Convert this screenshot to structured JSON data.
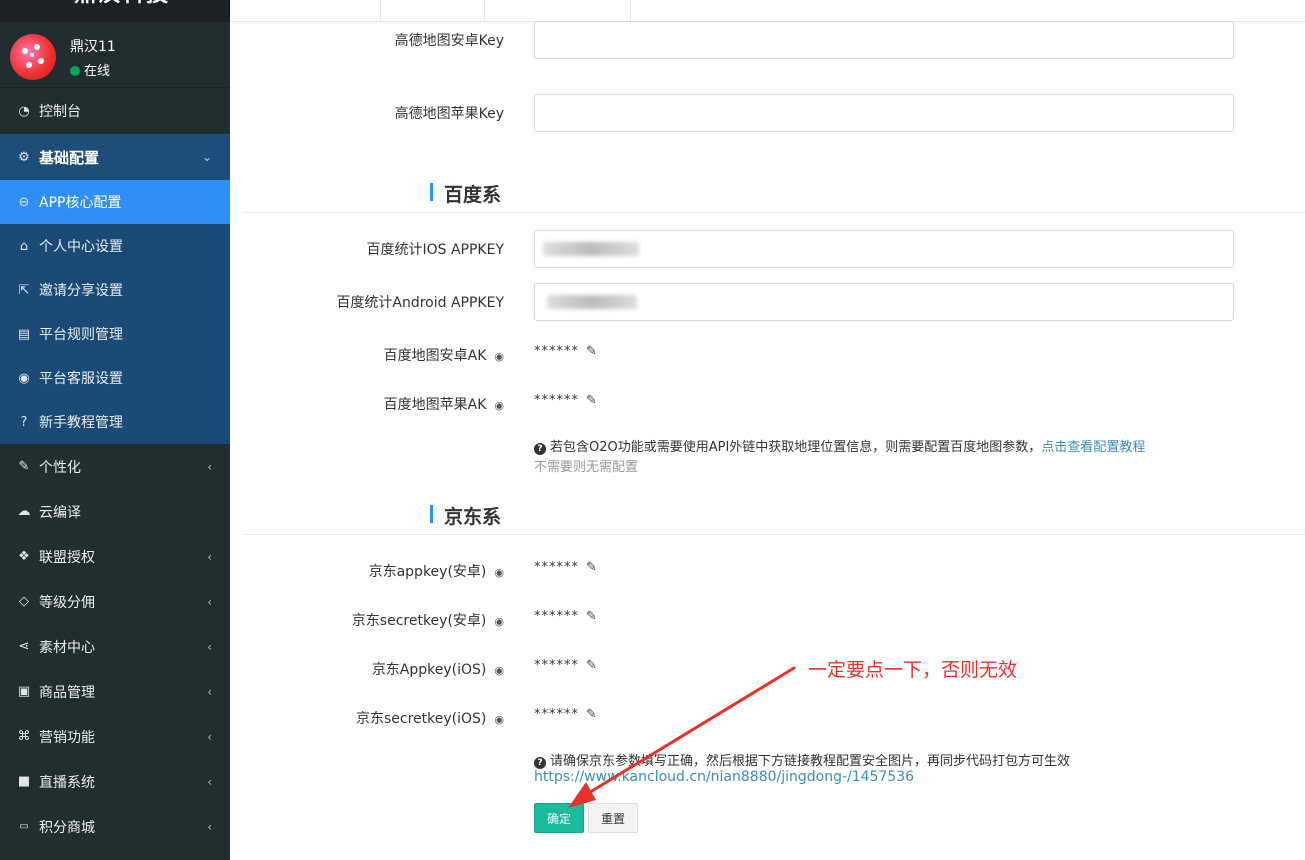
{
  "brand": {
    "title": "鼎汉科技"
  },
  "user": {
    "name": "鼎汉11",
    "status": "在线"
  },
  "sidebar": {
    "items": [
      {
        "label": "控制台",
        "icon": "dashboard-icon",
        "glyph": "◔"
      },
      {
        "label": "基础配置",
        "icon": "cogs-icon",
        "glyph": "⚙",
        "arrow": "⌄"
      },
      {
        "label": "APP核心配置",
        "icon": "circle-minus-icon",
        "glyph": "⊖"
      },
      {
        "label": "个人中心设置",
        "icon": "bank-icon",
        "glyph": "⌂"
      },
      {
        "label": "邀请分享设置",
        "icon": "share-square-icon",
        "glyph": "⇱"
      },
      {
        "label": "平台规则管理",
        "icon": "file-icon",
        "glyph": "▤"
      },
      {
        "label": "平台客服设置",
        "icon": "user-circle-icon",
        "glyph": "◉"
      },
      {
        "label": "新手教程管理",
        "icon": "question-circle-icon",
        "glyph": "?"
      },
      {
        "label": "个性化",
        "icon": "magic-icon",
        "glyph": "✎",
        "arrow": "‹"
      },
      {
        "label": "云编译",
        "icon": "cloud-icon",
        "glyph": "☁"
      },
      {
        "label": "联盟授权",
        "icon": "cubes-icon",
        "glyph": "❖",
        "arrow": "‹"
      },
      {
        "label": "等级分佣",
        "icon": "diamond-icon",
        "glyph": "◇",
        "arrow": "‹"
      },
      {
        "label": "素材中心",
        "icon": "share-alt-icon",
        "glyph": "⋖",
        "arrow": "‹"
      },
      {
        "label": "商品管理",
        "icon": "briefcase-icon",
        "glyph": "▣",
        "arrow": "‹"
      },
      {
        "label": "营销功能",
        "icon": "gift-icon",
        "glyph": "⌘",
        "arrow": "‹"
      },
      {
        "label": "直播系统",
        "icon": "video-camera-icon",
        "glyph": "■",
        "arrow": "‹"
      },
      {
        "label": "积分商城",
        "icon": "jcb-icon",
        "glyph": "▭",
        "arrow": "‹"
      }
    ]
  },
  "amap": {
    "android_key_label": "高德地图安卓Key",
    "ios_key_label": "高德地图苹果Key"
  },
  "baidu": {
    "section_title": "百度系",
    "stat_ios_label": "百度统计IOS APPKEY",
    "stat_android_label": "百度统计Android APPKEY",
    "map_android_label": "百度地图安卓AK",
    "map_ios_label": "百度地图苹果AK",
    "map_android_value": "******",
    "map_ios_value": "******",
    "help_text": "若包含O2O功能或需要使用API外链中获取地理位置信息，则需要配置百度地图参数，",
    "help_link": "点击查看配置教程",
    "help_note": "不需要则无需配置"
  },
  "jd": {
    "section_title": "京东系",
    "fields": [
      {
        "label": "京东appkey(安卓)",
        "value": "******"
      },
      {
        "label": "京东secretkey(安卓)",
        "value": "******"
      },
      {
        "label": "京东Appkey(iOS)",
        "value": "******"
      },
      {
        "label": "京东secretkey(iOS)",
        "value": "******"
      }
    ],
    "help_text": "请确保京东参数填写正确，然后根据下方链接教程配置安全图片，再同步代码打包方可生效",
    "help_link": "https://www.kancloud.cn/nian8880/jingdong-/1457536"
  },
  "buttons": {
    "confirm": "确定",
    "reset": "重置"
  },
  "annotation": {
    "text": "一定要点一下，否则无效",
    "color": "#e8312a"
  },
  "colors": {
    "sidebar_bg": "#222d32",
    "active": "#2f8ff4",
    "confirm": "#18bc9c"
  }
}
